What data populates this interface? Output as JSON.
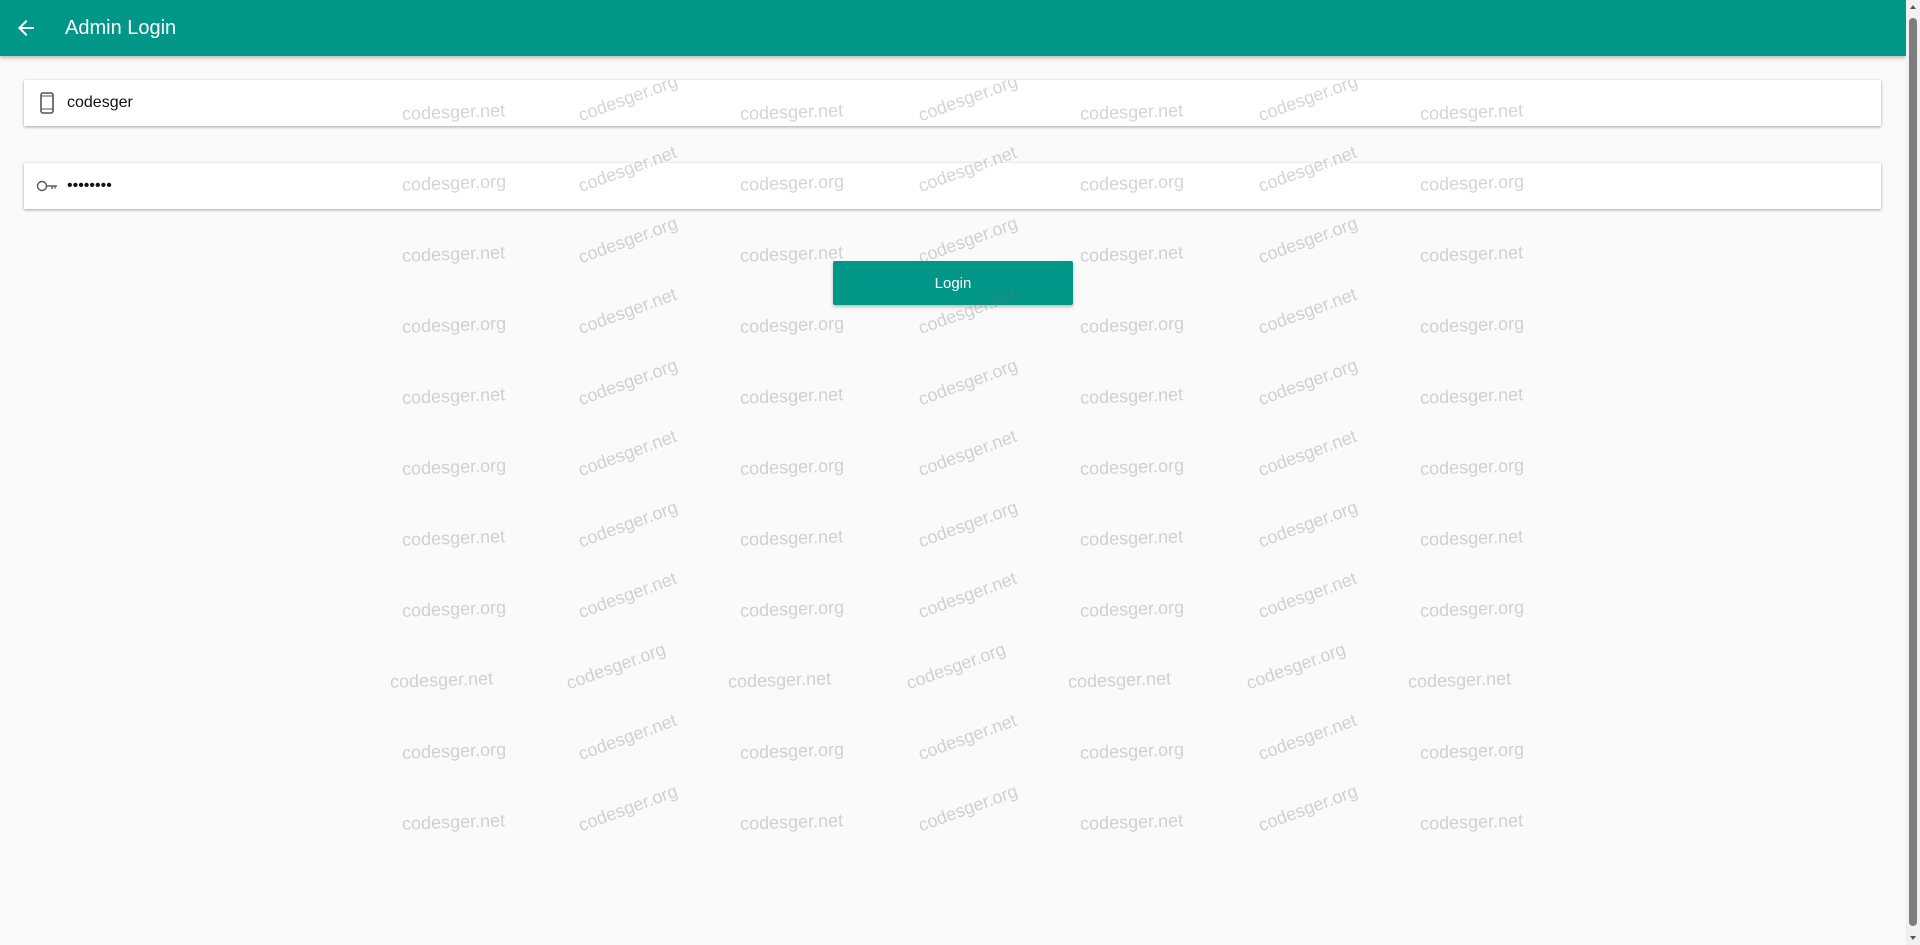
{
  "header": {
    "title": "Admin Login",
    "color": "#009688"
  },
  "form": {
    "username": {
      "value": "codesger",
      "icon": "phone-icon"
    },
    "password": {
      "value": "••••••••",
      "icon": "key-icon"
    },
    "login_label": "Login"
  },
  "watermark": {
    "text_a": "codesger.org",
    "text_b": "codesger.net"
  },
  "colors": {
    "accent": "#009688",
    "background": "#fafafa"
  }
}
